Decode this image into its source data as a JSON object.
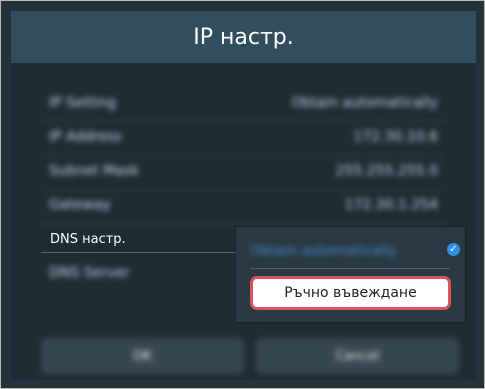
{
  "header": {
    "title": "IP настр."
  },
  "settings": {
    "rows": [
      {
        "label": "IP Setting",
        "value": "Obtain automatically"
      },
      {
        "label": "IP Address",
        "value": "172.30.10.6"
      },
      {
        "label": "Subnet Mask",
        "value": "255.255.255.0"
      },
      {
        "label": "Gateway",
        "value": "172.30.1.254"
      },
      {
        "label": "DNS Server",
        "value": ""
      }
    ],
    "dns_label": "DNS настр."
  },
  "dns_popup": {
    "option_auto": "Obtain automatically",
    "option_manual": "Ръчно въвеждане",
    "selected_icon": "checkmark-icon"
  },
  "footer": {
    "ok_label": "OK",
    "cancel_label": "Cancel"
  }
}
